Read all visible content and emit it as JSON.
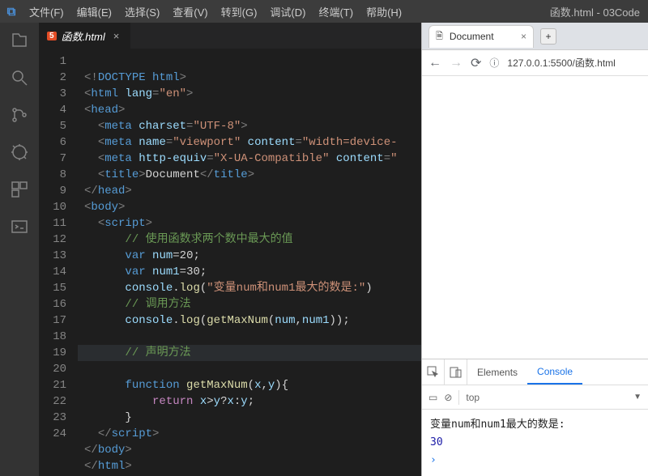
{
  "titlebar": {
    "menus": [
      "文件(F)",
      "编辑(E)",
      "选择(S)",
      "查看(V)",
      "转到(G)",
      "调试(D)",
      "终端(T)",
      "帮助(H)"
    ],
    "window_title": "函数.html - 03Code"
  },
  "tab": {
    "filename": "函数.html"
  },
  "gutter_lines": [
    "1",
    "2",
    "3",
    "4",
    "5",
    "6",
    "7",
    "8",
    "9",
    "10",
    "11",
    "12",
    "13",
    "14",
    "15",
    "16",
    "17",
    "18",
    "19",
    "20",
    "21",
    "22",
    "23",
    "24"
  ],
  "code": {
    "l1_doctype": "DOCTYPE",
    "l1_html": "html",
    "l2_html": "html",
    "l2_attr": "lang",
    "l2_val": "\"en\"",
    "l3_head": "head",
    "l4_meta": "meta",
    "l4_attr": "charset",
    "l4_val": "\"UTF-8\"",
    "l5_meta": "meta",
    "l5_a1": "name",
    "l5_v1": "\"viewport\"",
    "l5_a2": "content",
    "l5_v2": "\"width=device-",
    "l6_meta": "meta",
    "l6_a1": "http-equiv",
    "l6_v1": "\"X-UA-Compatible\"",
    "l6_a2": "content",
    "l6_v2": "\"",
    "l7_title": "title",
    "l7_txt": "Document",
    "l8_head": "head",
    "l9_body": "body",
    "l10_script": "script",
    "l11_cm": "// 使用函数求两个数中最大的值",
    "l12_var": "var",
    "l12_n": "num",
    "l12_v": "20",
    "l13_var": "var",
    "l13_n": "num1",
    "l13_v": "30",
    "l14_obj": "console",
    "l14_fn": "log",
    "l14_str": "\"变量num和num1最大的数是:\"",
    "l15_cm": "// 调用方法",
    "l16_obj": "console",
    "l16_fn": "log",
    "l16_call": "getMaxNum",
    "l16_a": "num",
    "l16_b": "num1",
    "l18_cm": "// 声明方法",
    "l19_kw": "function",
    "l19_fn": "getMaxNum",
    "l19_p1": "x",
    "l19_p2": "y",
    "l20_ret": "return",
    "l20_expr_x": "x",
    "l20_expr_y": "y",
    "l22_script": "script",
    "l23_body": "body",
    "l24_html": "html"
  },
  "browser": {
    "tab_title": "Document",
    "url": "127.0.0.1:5500/函数.html",
    "dt_tabs": {
      "elements": "Elements",
      "console": "Console"
    },
    "dt_context": "top",
    "console_out_msg": "变量num和num1最大的数是:",
    "console_out_val": "30"
  },
  "chart_data": null
}
